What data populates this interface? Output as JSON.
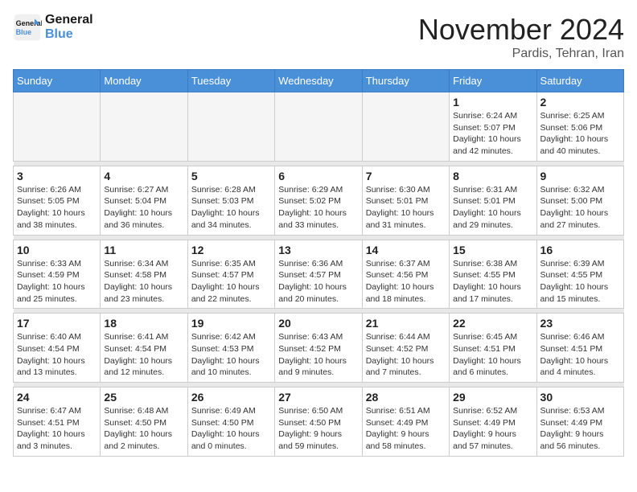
{
  "logo": {
    "line1": "General",
    "line2": "Blue"
  },
  "title": "November 2024",
  "location": "Pardis, Tehran, Iran",
  "days_of_week": [
    "Sunday",
    "Monday",
    "Tuesday",
    "Wednesday",
    "Thursday",
    "Friday",
    "Saturday"
  ],
  "weeks": [
    [
      {
        "day": "",
        "info": ""
      },
      {
        "day": "",
        "info": ""
      },
      {
        "day": "",
        "info": ""
      },
      {
        "day": "",
        "info": ""
      },
      {
        "day": "",
        "info": ""
      },
      {
        "day": "1",
        "info": "Sunrise: 6:24 AM\nSunset: 5:07 PM\nDaylight: 10 hours\nand 42 minutes."
      },
      {
        "day": "2",
        "info": "Sunrise: 6:25 AM\nSunset: 5:06 PM\nDaylight: 10 hours\nand 40 minutes."
      }
    ],
    [
      {
        "day": "3",
        "info": "Sunrise: 6:26 AM\nSunset: 5:05 PM\nDaylight: 10 hours\nand 38 minutes."
      },
      {
        "day": "4",
        "info": "Sunrise: 6:27 AM\nSunset: 5:04 PM\nDaylight: 10 hours\nand 36 minutes."
      },
      {
        "day": "5",
        "info": "Sunrise: 6:28 AM\nSunset: 5:03 PM\nDaylight: 10 hours\nand 34 minutes."
      },
      {
        "day": "6",
        "info": "Sunrise: 6:29 AM\nSunset: 5:02 PM\nDaylight: 10 hours\nand 33 minutes."
      },
      {
        "day": "7",
        "info": "Sunrise: 6:30 AM\nSunset: 5:01 PM\nDaylight: 10 hours\nand 31 minutes."
      },
      {
        "day": "8",
        "info": "Sunrise: 6:31 AM\nSunset: 5:01 PM\nDaylight: 10 hours\nand 29 minutes."
      },
      {
        "day": "9",
        "info": "Sunrise: 6:32 AM\nSunset: 5:00 PM\nDaylight: 10 hours\nand 27 minutes."
      }
    ],
    [
      {
        "day": "10",
        "info": "Sunrise: 6:33 AM\nSunset: 4:59 PM\nDaylight: 10 hours\nand 25 minutes."
      },
      {
        "day": "11",
        "info": "Sunrise: 6:34 AM\nSunset: 4:58 PM\nDaylight: 10 hours\nand 23 minutes."
      },
      {
        "day": "12",
        "info": "Sunrise: 6:35 AM\nSunset: 4:57 PM\nDaylight: 10 hours\nand 22 minutes."
      },
      {
        "day": "13",
        "info": "Sunrise: 6:36 AM\nSunset: 4:57 PM\nDaylight: 10 hours\nand 20 minutes."
      },
      {
        "day": "14",
        "info": "Sunrise: 6:37 AM\nSunset: 4:56 PM\nDaylight: 10 hours\nand 18 minutes."
      },
      {
        "day": "15",
        "info": "Sunrise: 6:38 AM\nSunset: 4:55 PM\nDaylight: 10 hours\nand 17 minutes."
      },
      {
        "day": "16",
        "info": "Sunrise: 6:39 AM\nSunset: 4:55 PM\nDaylight: 10 hours\nand 15 minutes."
      }
    ],
    [
      {
        "day": "17",
        "info": "Sunrise: 6:40 AM\nSunset: 4:54 PM\nDaylight: 10 hours\nand 13 minutes."
      },
      {
        "day": "18",
        "info": "Sunrise: 6:41 AM\nSunset: 4:54 PM\nDaylight: 10 hours\nand 12 minutes."
      },
      {
        "day": "19",
        "info": "Sunrise: 6:42 AM\nSunset: 4:53 PM\nDaylight: 10 hours\nand 10 minutes."
      },
      {
        "day": "20",
        "info": "Sunrise: 6:43 AM\nSunset: 4:52 PM\nDaylight: 10 hours\nand 9 minutes."
      },
      {
        "day": "21",
        "info": "Sunrise: 6:44 AM\nSunset: 4:52 PM\nDaylight: 10 hours\nand 7 minutes."
      },
      {
        "day": "22",
        "info": "Sunrise: 6:45 AM\nSunset: 4:51 PM\nDaylight: 10 hours\nand 6 minutes."
      },
      {
        "day": "23",
        "info": "Sunrise: 6:46 AM\nSunset: 4:51 PM\nDaylight: 10 hours\nand 4 minutes."
      }
    ],
    [
      {
        "day": "24",
        "info": "Sunrise: 6:47 AM\nSunset: 4:51 PM\nDaylight: 10 hours\nand 3 minutes."
      },
      {
        "day": "25",
        "info": "Sunrise: 6:48 AM\nSunset: 4:50 PM\nDaylight: 10 hours\nand 2 minutes."
      },
      {
        "day": "26",
        "info": "Sunrise: 6:49 AM\nSunset: 4:50 PM\nDaylight: 10 hours\nand 0 minutes."
      },
      {
        "day": "27",
        "info": "Sunrise: 6:50 AM\nSunset: 4:50 PM\nDaylight: 9 hours\nand 59 minutes."
      },
      {
        "day": "28",
        "info": "Sunrise: 6:51 AM\nSunset: 4:49 PM\nDaylight: 9 hours\nand 58 minutes."
      },
      {
        "day": "29",
        "info": "Sunrise: 6:52 AM\nSunset: 4:49 PM\nDaylight: 9 hours\nand 57 minutes."
      },
      {
        "day": "30",
        "info": "Sunrise: 6:53 AM\nSunset: 4:49 PM\nDaylight: 9 hours\nand 56 minutes."
      }
    ]
  ]
}
